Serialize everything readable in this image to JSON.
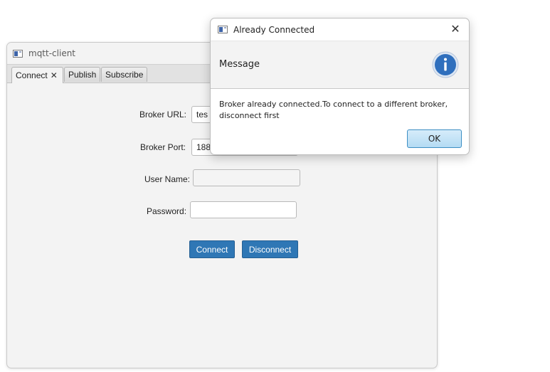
{
  "main_window": {
    "title": "mqtt-client",
    "tabs": [
      {
        "label": "Connect",
        "close_glyph": "✕"
      },
      {
        "label": "Publish"
      },
      {
        "label": "Subscribe"
      }
    ],
    "form": {
      "broker_url_label": "Broker URL:",
      "broker_url_value": "tes",
      "broker_port_label": "Broker Port:",
      "broker_port_value": "188",
      "user_name_label": "User Name:",
      "user_name_value": "",
      "password_label": "Password:",
      "password_value": ""
    },
    "buttons": {
      "connect": "Connect",
      "disconnect": "Disconnect"
    }
  },
  "dialog": {
    "title": "Already Connected",
    "close_glyph": "✕",
    "header": "Message",
    "header_icon": "info-icon",
    "body": "Broker already connected.To connect to a different broker, disconnect first",
    "ok_label": "OK",
    "colors": {
      "info_icon": "#2f6fbd",
      "ok_border": "#3d8fc4"
    }
  }
}
